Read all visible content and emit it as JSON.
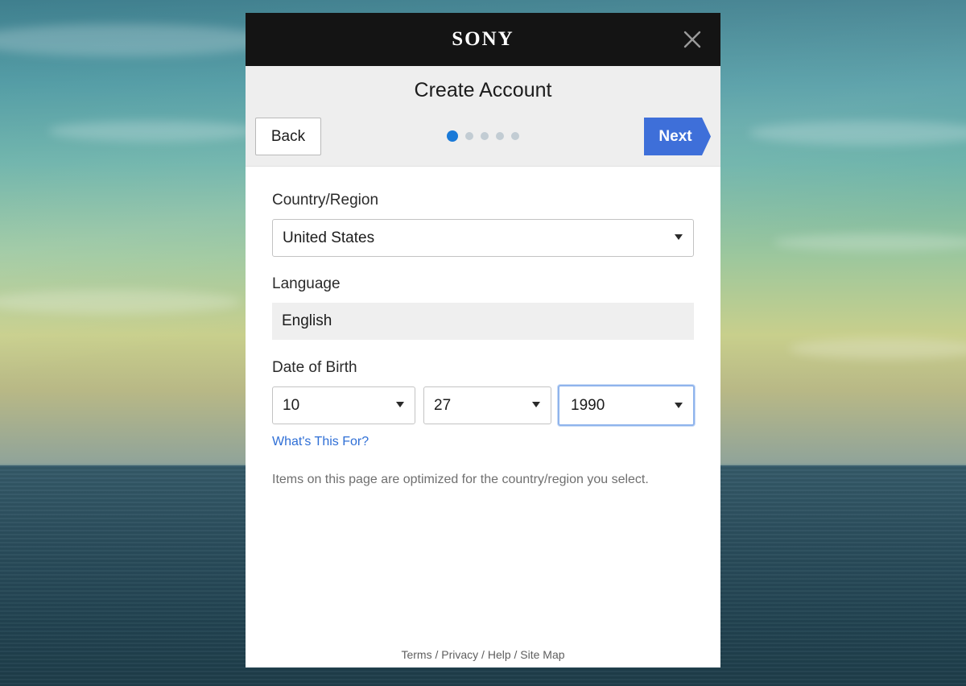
{
  "header": {
    "brand": "SONY",
    "close_icon": "close-icon",
    "title": "Create Account"
  },
  "navigation": {
    "back_label": "Back",
    "next_label": "Next",
    "step_current": 1,
    "step_total": 5,
    "accent_color": "#1a7ad8",
    "next_color": "#3e6fd9"
  },
  "form": {
    "country_label": "Country/Region",
    "country_value": "United States",
    "language_label": "Language",
    "language_value": "English",
    "dob_label": "Date of Birth",
    "dob_month": "10",
    "dob_day": "27",
    "dob_year": "1990",
    "help_link": "What's This For?",
    "note": "Items on this page are optimized for the country/region you select."
  },
  "footer": {
    "links": [
      "Terms",
      "Privacy",
      "Help",
      "Site Map"
    ],
    "separator": "/"
  }
}
